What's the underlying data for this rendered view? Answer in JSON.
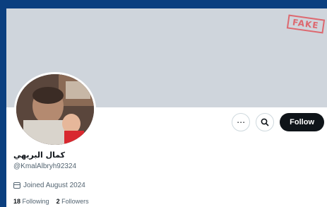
{
  "stamp": "FAKE",
  "profile": {
    "display_name": "كمال البريهي",
    "handle": "@KmalAlbryh92324",
    "joined": "Joined August 2024",
    "following_count": "18",
    "following_label": "Following",
    "followers_count": "2",
    "followers_label": "Followers"
  },
  "actions": {
    "more_icon": "ellipsis-icon",
    "search_icon": "search-icon",
    "follow_label": "Follow"
  },
  "colors": {
    "background": "#0b3f7f",
    "banner": "#cfd5dc",
    "stamp": "#e0555d",
    "follow_button": "#0f1419"
  }
}
